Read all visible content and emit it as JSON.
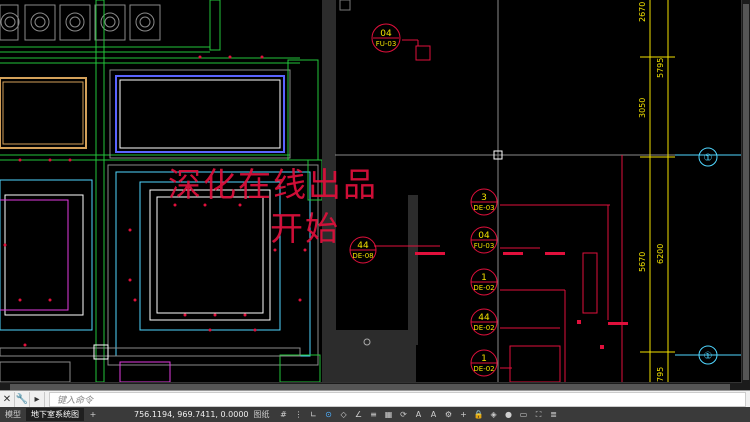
{
  "drawing": {
    "tags": [
      {
        "num": "04",
        "code": "FU-03"
      },
      {
        "num": "3",
        "code": "DE-03"
      },
      {
        "num": "04",
        "code": "FU-03"
      },
      {
        "num": "44",
        "code": "DE-08"
      },
      {
        "num": "1",
        "code": "DE-02"
      },
      {
        "num": "44",
        "code": "DE-02"
      },
      {
        "num": "1",
        "code": "DE-02"
      }
    ],
    "dimensions": [
      "2670",
      "5795",
      "3050",
      "5670",
      "6200",
      "795"
    ],
    "axis_labels": [
      "①",
      "①"
    ]
  },
  "watermark": {
    "line1": "深化在线出品",
    "line2": "开始"
  },
  "cmd": {
    "prompt": "键入命令"
  },
  "status": {
    "tabs": [
      "模型",
      "地下室系统图"
    ],
    "coords": "756.1194, 969.7411, 0.0000",
    "mode": "图纸"
  },
  "colors": {
    "red": "#e0103c",
    "green": "#22c43a",
    "cyan": "#4fd6ff",
    "yellow": "#f2e100",
    "magenta": "#e23be0",
    "blue": "#5a64ff"
  }
}
